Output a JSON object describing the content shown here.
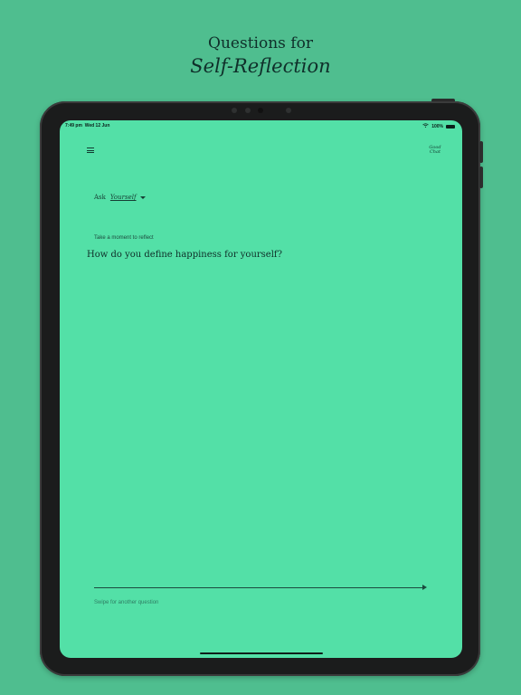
{
  "heading": {
    "line1": "Questions for",
    "line2": "Self-Reflection"
  },
  "status_bar": {
    "time": "7:49 pm",
    "date": "Wed 12 Jun",
    "battery": "100%",
    "wifi_icon": "wifi-icon",
    "battery_icon": "battery-icon"
  },
  "app": {
    "logo_line1": "Good",
    "logo_line2": "Chat",
    "menu_icon": "hamburger-menu-icon",
    "ask_label": "Ask",
    "ask_target": "Yourself",
    "prompt": "Take a moment to reflect",
    "question": "How do you define happiness for yourself?",
    "swipe_hint": "Swipe for another question"
  },
  "colors": {
    "background": "#4fbe8f",
    "screen": "#53e0a7",
    "device": "#1b1c1c",
    "text_dark": "#0f2f2a"
  }
}
